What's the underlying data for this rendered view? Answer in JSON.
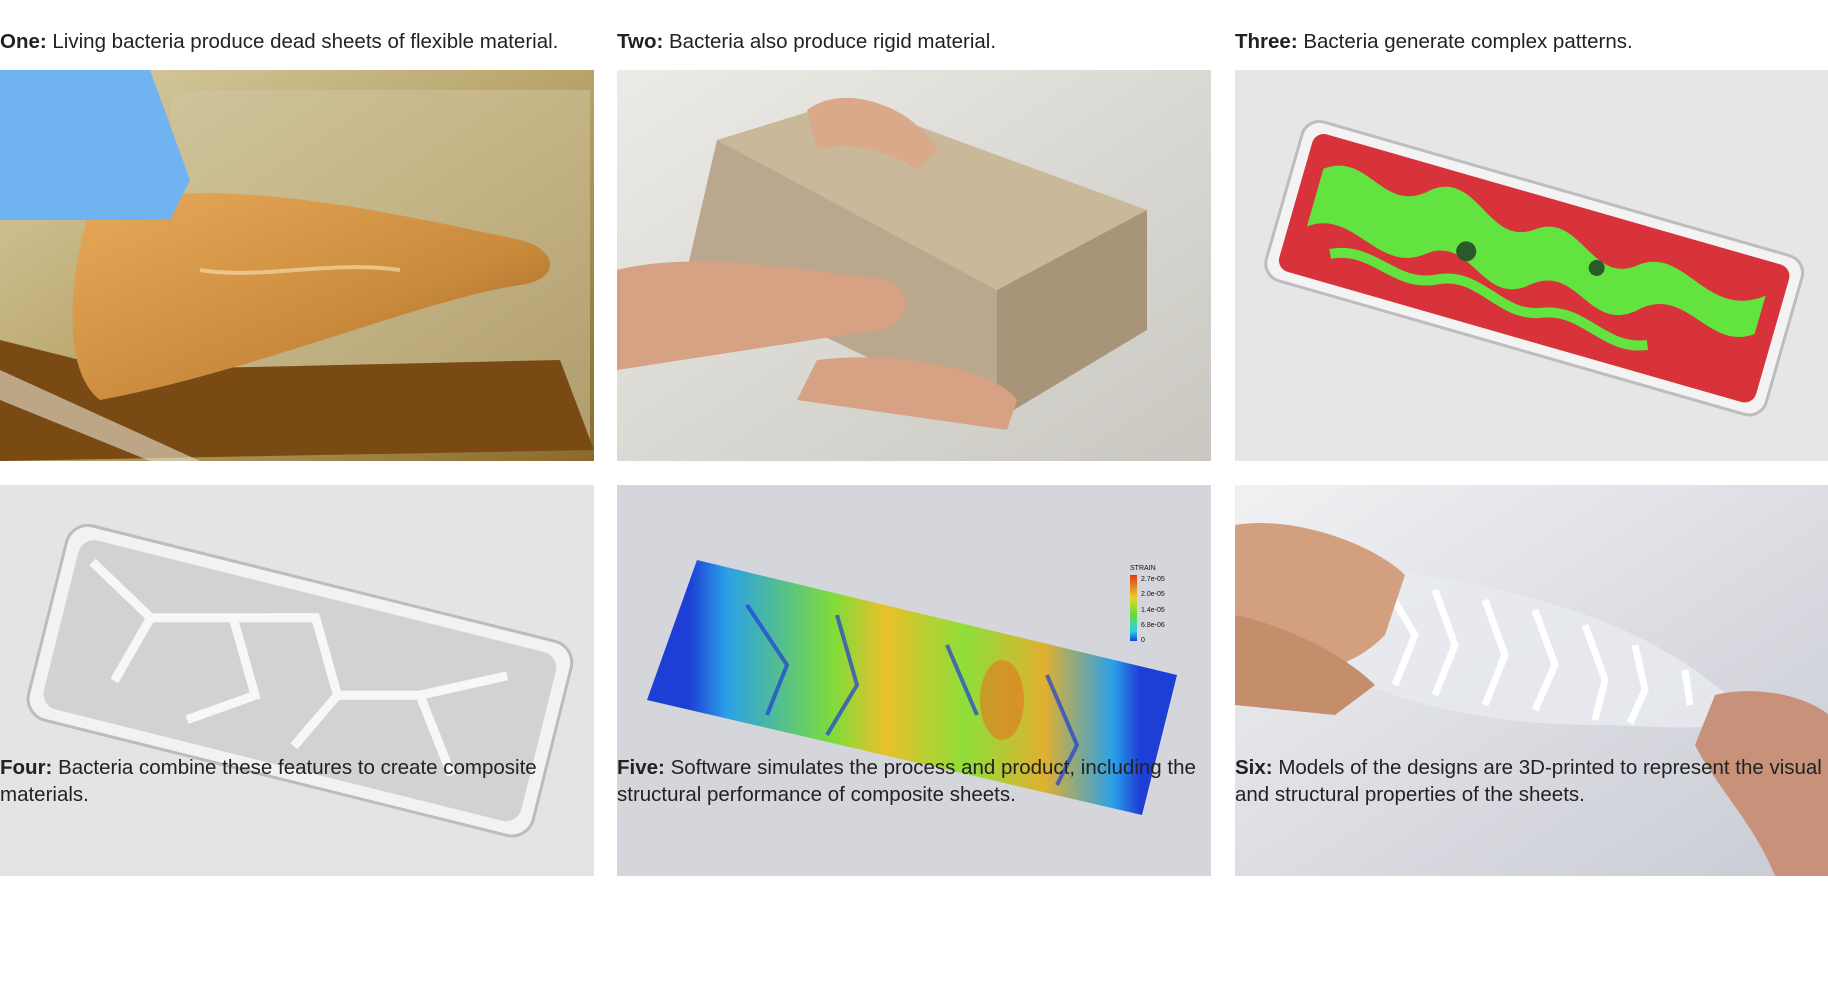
{
  "panels": [
    {
      "label": "One:",
      "caption": "Living bacteria produce dead sheets of flexible material."
    },
    {
      "label": "Two:",
      "caption": "Bacteria also produce rigid material."
    },
    {
      "label": "Three:",
      "caption": "Bacteria generate complex patterns."
    },
    {
      "label": "Four:",
      "caption": "Bacteria combine these features to create composite materials."
    },
    {
      "label": "Five:",
      "caption": "Software simulates the process and product, including the structural performance of composite sheets."
    },
    {
      "label": "Six:",
      "caption": "Models of the designs are 3D-printed to represent the visual and structural properties of the sheets."
    }
  ],
  "simulation_legend": {
    "title": "STRAIN",
    "ticks": [
      "2.7e-05",
      "2.0e-05",
      "1.4e-05",
      "6.8e-06",
      "0"
    ]
  },
  "colors": {
    "glove": "#6fb4f0",
    "cellulose": "#c98a3c",
    "brick": "#b9a78e",
    "pattern_red": "#d8333a",
    "pattern_green": "#63e33f",
    "sim_low": "#1d3fd6",
    "sim_high": "#e23b1c"
  }
}
